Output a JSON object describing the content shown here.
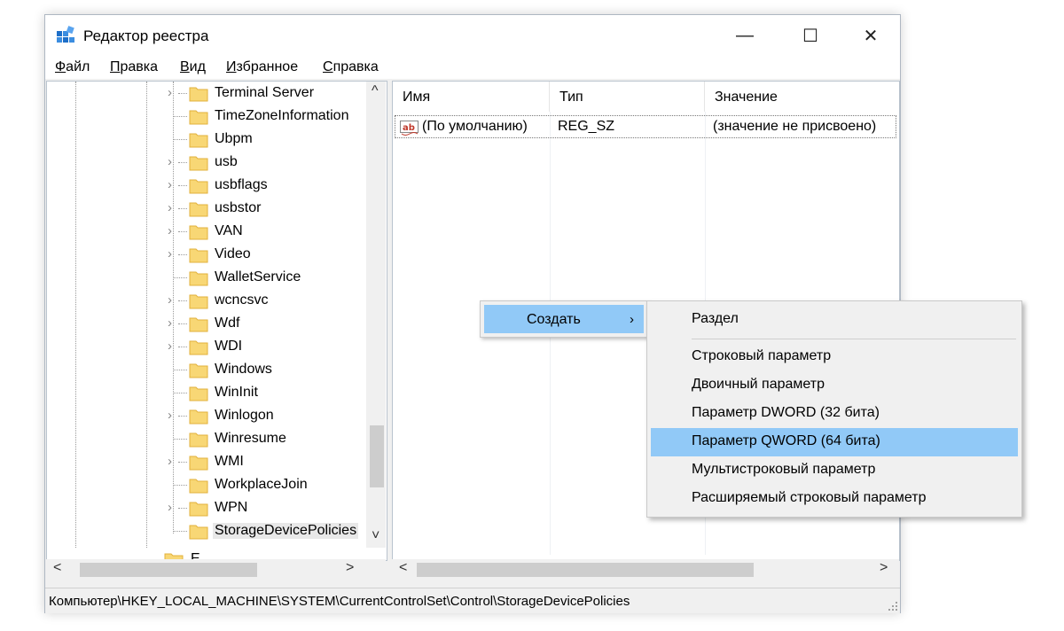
{
  "window": {
    "title": "Редактор реестра",
    "minimize": "—",
    "maximize": "☐",
    "close": "✕"
  },
  "menu": [
    {
      "underline": "Ф",
      "rest": "айл"
    },
    {
      "underline": "П",
      "rest": "равка"
    },
    {
      "underline": "В",
      "rest": "ид"
    },
    {
      "underline": "И",
      "rest": "збранное"
    },
    {
      "underline": "С",
      "rest": "правка"
    }
  ],
  "tree": {
    "items": [
      {
        "label": "Terminal Server",
        "expandable": true
      },
      {
        "label": "TimeZoneInformation",
        "expandable": false
      },
      {
        "label": "Ubpm",
        "expandable": false
      },
      {
        "label": "usb",
        "expandable": true
      },
      {
        "label": "usbflags",
        "expandable": true
      },
      {
        "label": "usbstor",
        "expandable": true
      },
      {
        "label": "VAN",
        "expandable": true
      },
      {
        "label": "Video",
        "expandable": true
      },
      {
        "label": "WalletService",
        "expandable": false
      },
      {
        "label": "wcncsvc",
        "expandable": true
      },
      {
        "label": "Wdf",
        "expandable": true
      },
      {
        "label": "WDI",
        "expandable": true
      },
      {
        "label": "Windows",
        "expandable": false
      },
      {
        "label": "WinInit",
        "expandable": false
      },
      {
        "label": "Winlogon",
        "expandable": true
      },
      {
        "label": "Winresume",
        "expandable": false
      },
      {
        "label": "WMI",
        "expandable": true
      },
      {
        "label": "WorkplaceJoin",
        "expandable": false
      },
      {
        "label": "WPN",
        "expandable": true
      },
      {
        "label": "StorageDevicePolicies",
        "expandable": false,
        "selected": true
      }
    ],
    "partial_item": "E"
  },
  "list": {
    "columns": [
      "Имя",
      "Тип",
      "Значение"
    ],
    "rows": [
      {
        "icon": "ab",
        "name": "(По умолчанию)",
        "type": "REG_SZ",
        "value": "(значение не присвоено)"
      }
    ]
  },
  "status": {
    "path": "Компьютер\\HKEY_LOCAL_MACHINE\\SYSTEM\\CurrentControlSet\\Control\\StorageDevicePolicies"
  },
  "context_menu": {
    "label": "Создать",
    "chevron": "›"
  },
  "submenu": {
    "items": [
      {
        "label": "Раздел"
      },
      {
        "label": "Строковый параметр"
      },
      {
        "label": "Двоичный параметр"
      },
      {
        "label": "Параметр DWORD (32 бита)"
      },
      {
        "label": "Параметр QWORD (64 бита)",
        "highlighted": true
      },
      {
        "label": "Мультистроковый параметр"
      },
      {
        "label": "Расширяемый строковый параметр"
      }
    ]
  },
  "scroll": {
    "up": "^",
    "down": "˅",
    "left": "<",
    "right": ">"
  },
  "colors": {
    "highlight": "#91c9f7",
    "folder": "#f8d775",
    "folder_dark": "#e2b13c"
  }
}
